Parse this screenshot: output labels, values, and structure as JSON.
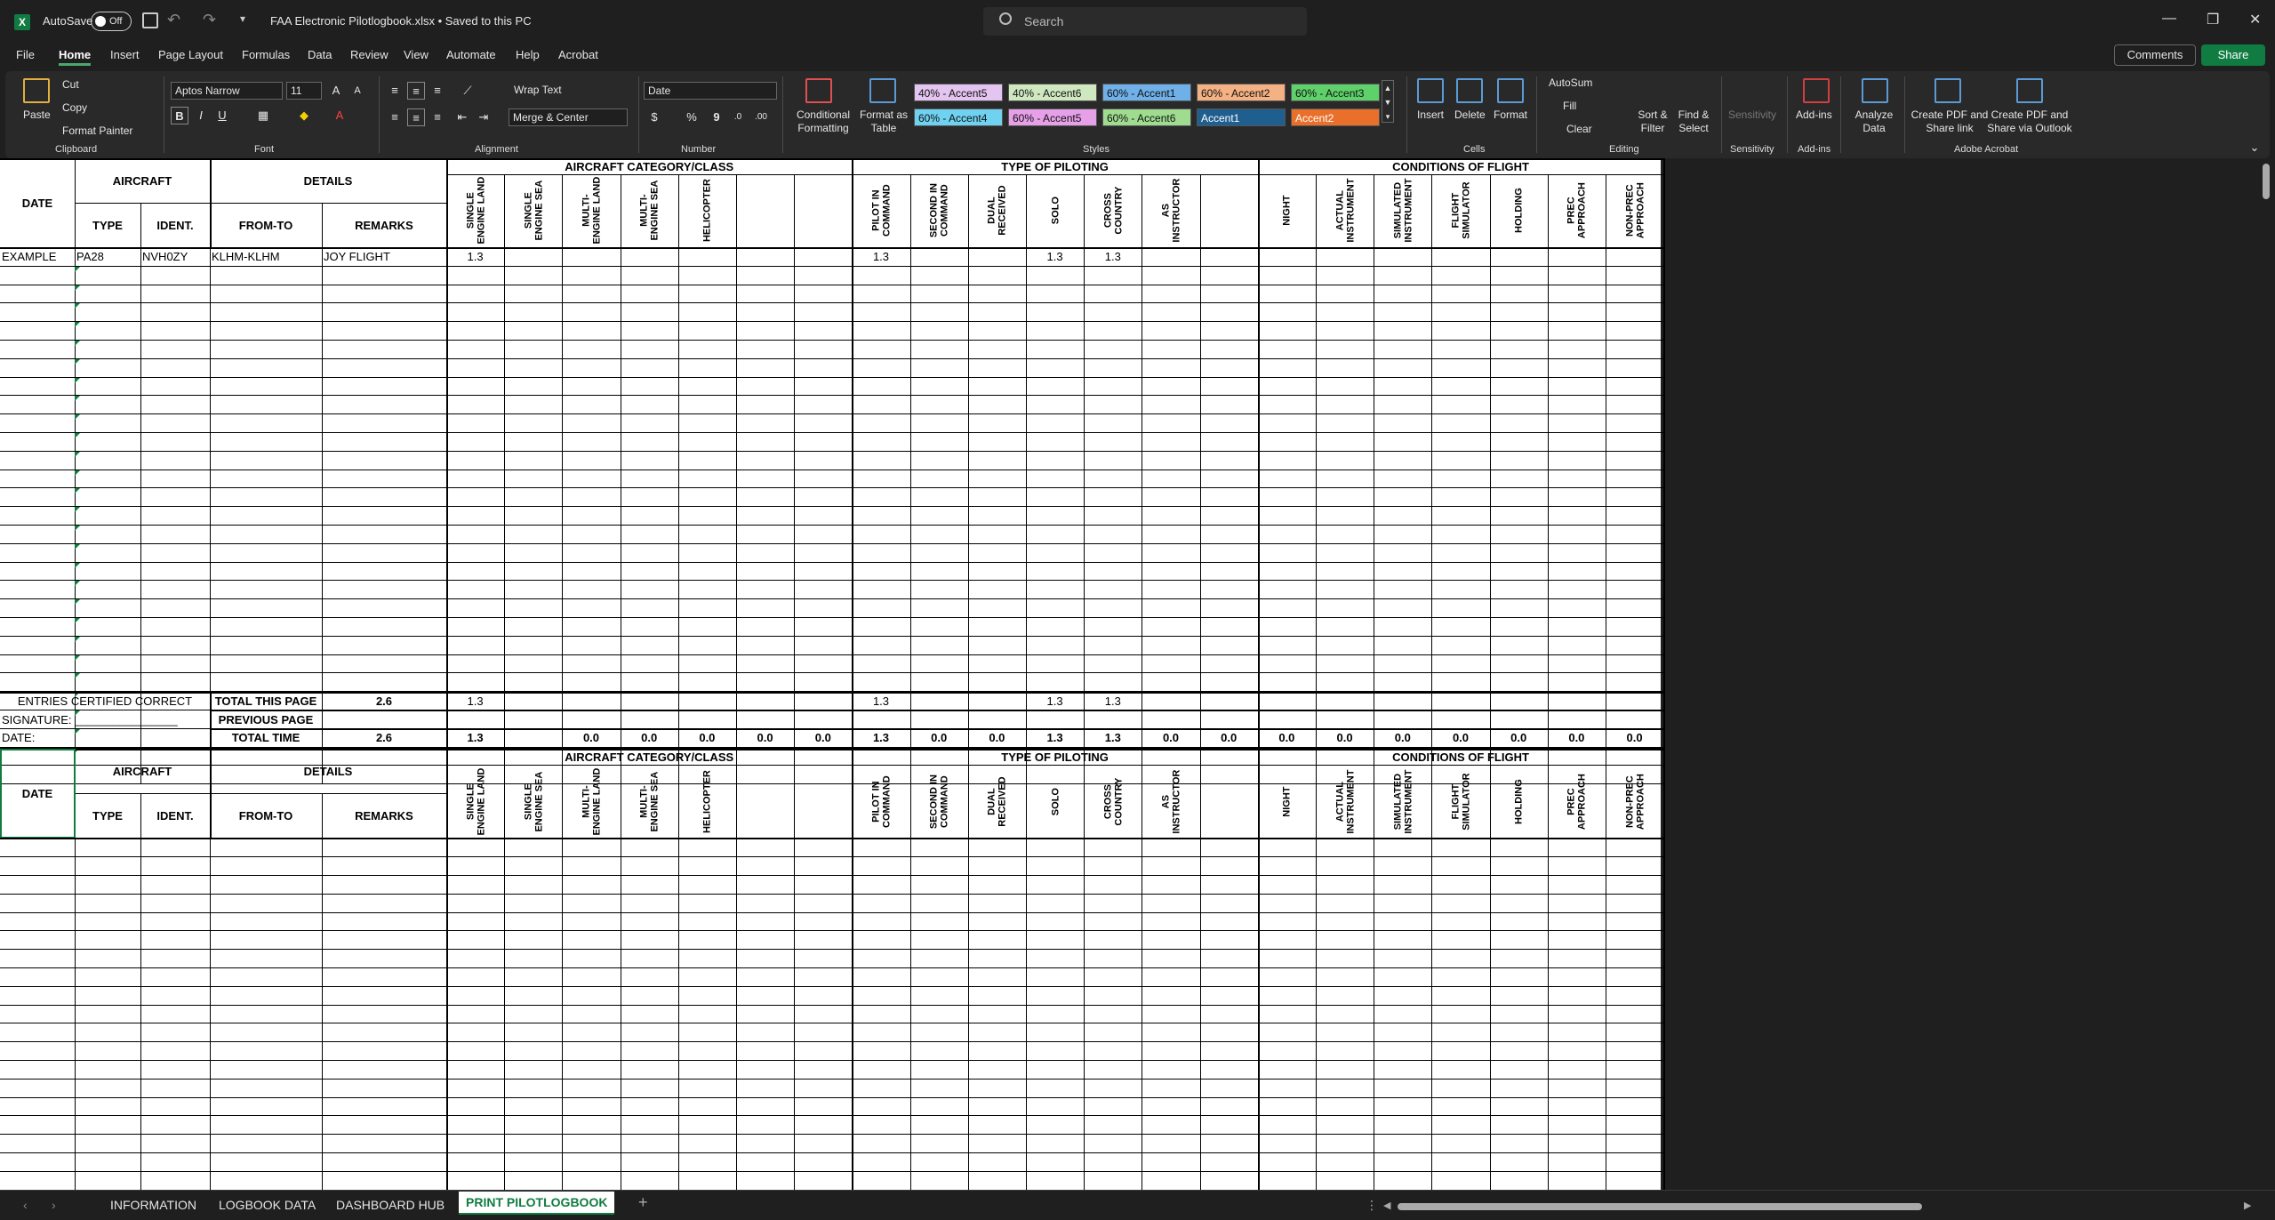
{
  "titlebar": {
    "autosave_label": "AutoSave",
    "autosave_state": "Off",
    "document_title": "FAA Electronic Pilotlogbook.xlsx  •  Saved to this PC",
    "search_placeholder": "Search"
  },
  "menu": [
    "File",
    "Home",
    "Insert",
    "Page Layout",
    "Formulas",
    "Data",
    "Review",
    "View",
    "Automate",
    "Help",
    "Acrobat"
  ],
  "menu_active": "Home",
  "actions": {
    "comments": "Comments",
    "share": "Share"
  },
  "ribbon": {
    "clipboard": {
      "paste": "Paste",
      "cut": "Cut",
      "copy": "Copy",
      "format_painter": "Format Painter",
      "label": "Clipboard"
    },
    "font": {
      "name": "Aptos Narrow",
      "size": "11",
      "label": "Font",
      "bold": "B",
      "italic": "I",
      "underline": "U"
    },
    "alignment": {
      "wrap": "Wrap Text",
      "merge": "Merge & Center",
      "label": "Alignment"
    },
    "number": {
      "format": "Date",
      "currency": "$",
      "percent": "%",
      "comma": "9",
      "label": "Number"
    },
    "styles": {
      "conditional": "Conditional Formatting",
      "format_table": "Format as Table",
      "cells": [
        {
          "text": "40% - Accent5",
          "bg": "#e4c4f0"
        },
        {
          "text": "40% - Accent6",
          "bg": "#cfe8c0"
        },
        {
          "text": "60% - Accent1",
          "bg": "#6fb0e8"
        },
        {
          "text": "60% - Accent2",
          "bg": "#f4b183"
        },
        {
          "text": "60% - Accent3",
          "bg": "#5fd16a"
        },
        {
          "text": "60% - Accent4",
          "bg": "#6fd2f0"
        },
        {
          "text": "60% - Accent5",
          "bg": "#e6a0e8"
        },
        {
          "text": "60% - Accent6",
          "bg": "#9fdc8f"
        },
        {
          "text": "Accent1",
          "bg": "#1f5f8f"
        },
        {
          "text": "Accent2",
          "bg": "#e8702a"
        }
      ],
      "label": "Styles"
    },
    "cells": {
      "insert": "Insert",
      "delete": "Delete",
      "format": "Format",
      "label": "Cells"
    },
    "editing": {
      "autosum": "AutoSum",
      "fill": "Fill",
      "clear": "Clear",
      "sort_filter": "Sort & Filter",
      "find_select": "Find & Select",
      "label": "Editing"
    },
    "sensitivity": {
      "button": "Sensitivity",
      "label": "Sensitivity"
    },
    "addins": {
      "button": "Add-ins",
      "label": "Add-ins"
    },
    "analyze": {
      "button": "Analyze Data"
    },
    "acrobat": {
      "create_pdf": "Create PDF and Share link",
      "create_pdf_outlook": "Create PDF and Share via Outlook",
      "label": "Adobe Acrobat"
    }
  },
  "logbook": {
    "headers": {
      "date": "DATE",
      "aircraft": "AIRCRAFT",
      "type": "TYPE",
      "ident": "IDENT.",
      "details": "DETAILS",
      "from_to": "FROM-TO",
      "remarks": "REMARKS",
      "category": "AIRCRAFT CATEGORY/CLASS",
      "piloting": "TYPE OF PILOTING",
      "conditions": "CONDITIONS OF FLIGHT"
    },
    "category_cols": [
      "SINGLE\nENGINE LAND",
      "SINGLE\nENGINE SEA",
      "MULTI-\nENGINE LAND",
      "MULTI-\nENGINE SEA",
      "HELICOPTER",
      "",
      ""
    ],
    "piloting_cols": [
      "PILOT IN\nCOMMAND",
      "SECOND IN\nCOMMAND",
      "DUAL\nRECEIVED",
      "SOLO",
      "CROSS\nCOUNTRY",
      "AS\nINSTRUCTOR",
      ""
    ],
    "conditions_cols": [
      "NIGHT",
      "ACTUAL\nINSTRUMENT",
      "SIMULATED\nINSTRUMENT",
      "FLIGHT\nSIMULATOR",
      "HOLDING",
      "PREC\nAPPROACH",
      "NON-PREC\nAPPROACH"
    ],
    "example": {
      "date": "EXAMPLE",
      "type": "PA28",
      "ident": "NVH0ZY",
      "from_to": "KLHM-KLHM",
      "remarks": "JOY FLIGHT",
      "values": [
        "1.3",
        "",
        "",
        "",
        "",
        "",
        "",
        "1.3",
        "",
        "",
        "1.3",
        "1.3",
        "",
        "",
        "",
        "",
        "",
        "",
        "",
        "",
        ""
      ]
    },
    "totals": {
      "certified": "ENTRIES CERTIFIED CORRECT",
      "signature": "SIGNATURE: ________________",
      "date": "DATE: ",
      "this_page_label": "TOTAL THIS PAGE",
      "this_page_value": "2.6",
      "previous_label": "PREVIOUS PAGE",
      "total_label": "TOTAL TIME",
      "total_value": "2.6",
      "this_page": [
        "1.3",
        "",
        "",
        "",
        "",
        "",
        "",
        "1.3",
        "",
        "",
        "1.3",
        "1.3",
        "",
        "",
        "",
        "",
        "",
        "",
        "",
        "",
        ""
      ],
      "total": [
        "1.3",
        "",
        "0.0",
        "0.0",
        "0.0",
        "0.0",
        "0.0",
        "1.3",
        "0.0",
        "0.0",
        "1.3",
        "1.3",
        "0.0",
        "0.0",
        "0.0",
        "0.0",
        "0.0",
        "0.0",
        "0.0",
        "0.0",
        "0.0"
      ]
    }
  },
  "sheet_tabs": [
    "INFORMATION",
    "LOGBOOK DATA",
    "DASHBOARD HUB",
    "PRINT PILOTLOGBOOK"
  ],
  "sheet_active": "PRINT PILOTLOGBOOK"
}
